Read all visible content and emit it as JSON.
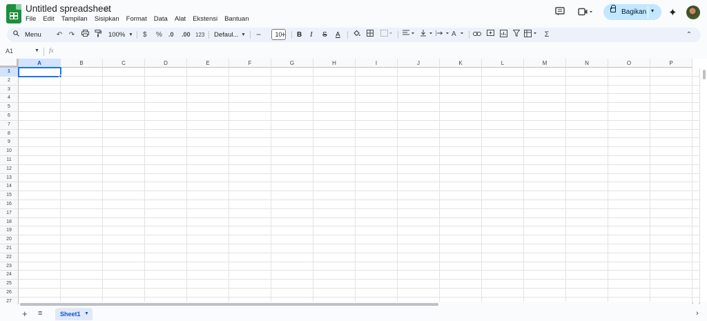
{
  "app": {
    "doc_title": "Untitled spreadsheet"
  },
  "menu": [
    "File",
    "Edit",
    "Tampilan",
    "Sisipkan",
    "Format",
    "Data",
    "Alat",
    "Ekstensi",
    "Bantuan"
  ],
  "header": {
    "share_label": "Bagikan"
  },
  "toolbar": {
    "search_label": "Menu",
    "zoom": "100%",
    "currency": "$",
    "percent": "%",
    "dec_decrease": ".0",
    "dec_increase": ".00",
    "number_format": "123",
    "font": "Defaul...",
    "font_size": "10",
    "bold": "B",
    "italic": "I",
    "text_color": "A"
  },
  "formula_bar": {
    "cell_ref": "A1",
    "fx": "fx"
  },
  "grid": {
    "columns": [
      "A",
      "B",
      "C",
      "D",
      "E",
      "F",
      "G",
      "H",
      "I",
      "J",
      "K",
      "L",
      "M",
      "N",
      "O",
      "P"
    ],
    "rows": [
      "1",
      "2",
      "3",
      "4",
      "5",
      "6",
      "7",
      "8",
      "9",
      "10",
      "11",
      "12",
      "13",
      "14",
      "15",
      "16",
      "17",
      "18",
      "19",
      "20",
      "21",
      "22",
      "23",
      "24",
      "25",
      "26",
      "27"
    ],
    "selected_cell": "A1"
  },
  "sheets": {
    "tabs": [
      "Sheet1"
    ],
    "active": "Sheet1"
  },
  "colors": {
    "accent": "#1a73e8",
    "share_bg": "#c2e7ff",
    "toolbar_bg": "#edf2fa",
    "logo": "#1e8e3e"
  }
}
